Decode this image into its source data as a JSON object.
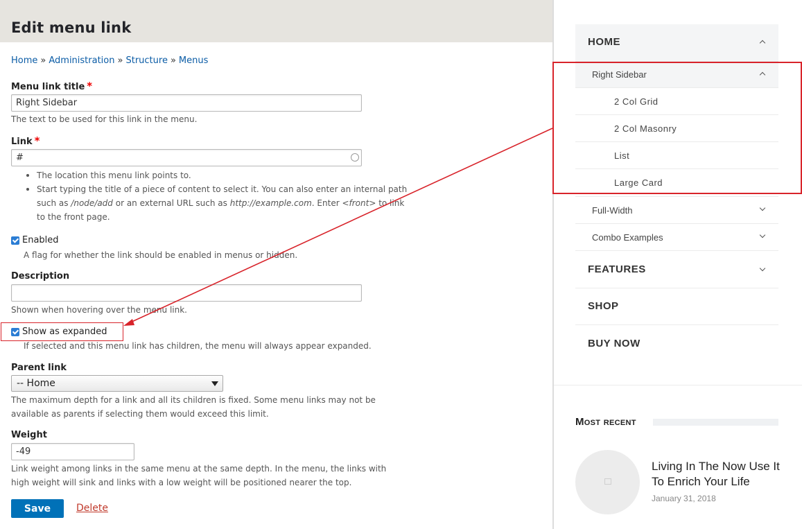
{
  "admin": {
    "page_title": "Edit menu link",
    "breadcrumb": [
      "Home",
      "Administration",
      "Structure",
      "Menus"
    ],
    "breadcrumb_sep": "»",
    "menu_link_title": {
      "label": "Menu link title",
      "required_mark": "*",
      "value": "Right Sidebar",
      "description": "The text to be used for this link in the menu."
    },
    "link": {
      "label": "Link",
      "required_mark": "*",
      "value": "#",
      "help_1": "The location this menu link points to.",
      "help_2_pre": "Start typing the title of a piece of content to select it. You can also enter an internal path such as ",
      "help_2_path": "/node/add",
      "help_2_mid": " or an external URL such as ",
      "help_2_url": "http://example.com",
      "help_2_mid2": ". Enter ",
      "help_2_front": "<front>",
      "help_2_post": " to link to the front page."
    },
    "enabled": {
      "label": "Enabled",
      "checked": true,
      "description": "A flag for whether the link should be enabled in menus or hidden."
    },
    "description_field": {
      "label": "Description",
      "value": "",
      "description": "Shown when hovering over the menu link."
    },
    "expanded": {
      "label": "Show as expanded",
      "checked": true,
      "description": "If selected and this menu link has children, the menu will always appear expanded."
    },
    "parent_link": {
      "label": "Parent link",
      "selected": "-- Home",
      "description_1": "The maximum depth for a link and all its children is fixed. Some menu links may not be",
      "description_2": "available as parents if selecting them would exceed this limit."
    },
    "weight": {
      "label": "Weight",
      "value": "-49",
      "description_1": "Link weight among links in the same menu at the same depth. In the menu, the links with",
      "description_2": "high weight will sink and links with a low weight will be positioned nearer the top."
    },
    "save_label": "Save",
    "delete_label": "Delete"
  },
  "site_menu": {
    "home": "HOME",
    "right_sidebar": "Right Sidebar",
    "children": [
      "2 Col Grid",
      "2 Col Masonry",
      "List",
      "Large Card"
    ],
    "full_width": "Full-Width",
    "combo_examples": "Combo Examples",
    "features": "FEATURES",
    "shop": "SHOP",
    "buy_now": "BUY NOW"
  },
  "most_recent": {
    "heading": "Most recent",
    "post_title": "Living In The Now Use It To Enrich Your Life",
    "post_date": "January 31, 2018"
  },
  "colors": {
    "link_blue": "#0b5ca6",
    "save_blue": "#0071b8",
    "annotation_red": "#d8232a",
    "header_bg": "#e6e4df"
  }
}
